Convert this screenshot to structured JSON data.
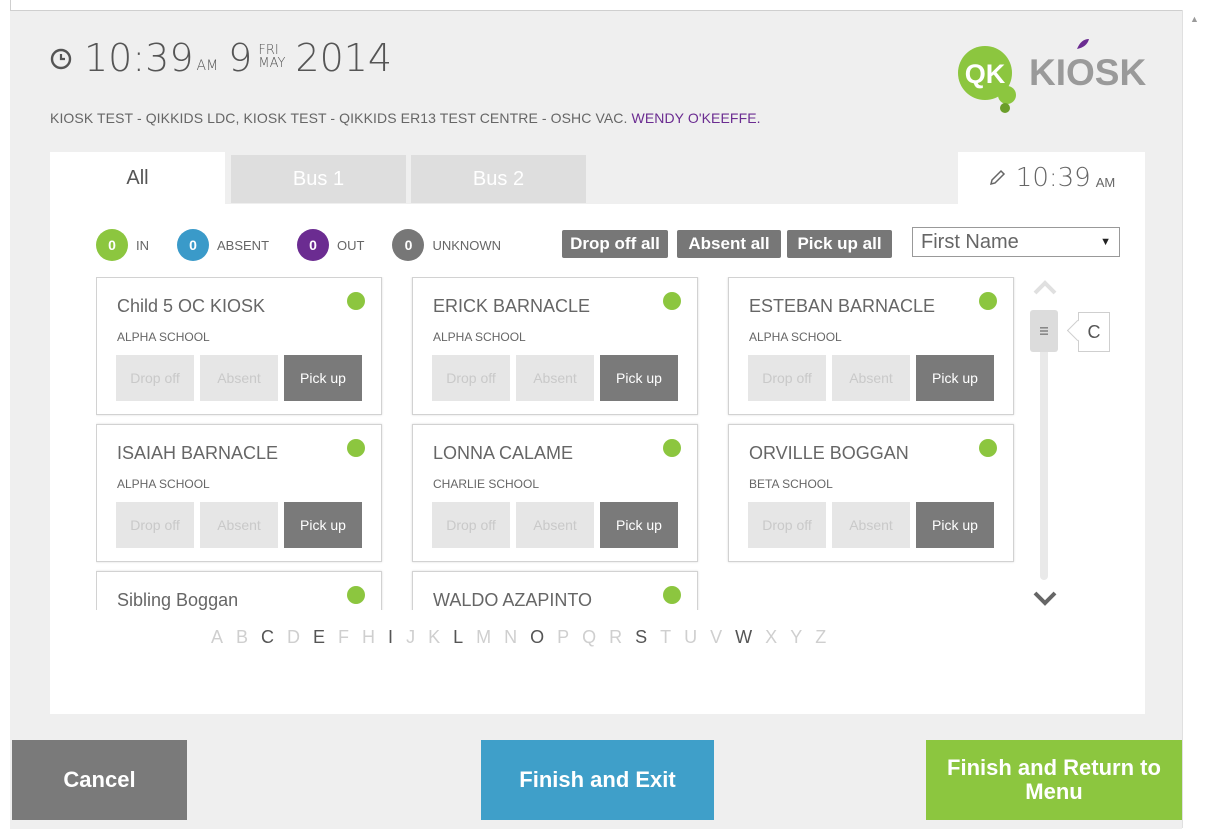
{
  "header": {
    "time": "10:39",
    "ampm": "AM",
    "day_num": "9",
    "day_name": "FRI",
    "month": "MAY",
    "year": "2014",
    "centres": "KIOSK TEST - QIKKIDS LDC, KIOSK TEST - QIKKIDS ER13 TEST CENTRE - OSHC VAC.",
    "user": "WENDY O'KEEFFE."
  },
  "logo": {
    "mark": "QK",
    "word": "KIOSK"
  },
  "tabs": [
    {
      "label": "All",
      "active": true
    },
    {
      "label": "Bus 1",
      "active": false
    },
    {
      "label": "Bus 2",
      "active": false
    }
  ],
  "tab_time": {
    "time": "10:39",
    "ampm": "AM"
  },
  "legend": [
    {
      "count": "0",
      "label": "IN",
      "color": "#8cc63f"
    },
    {
      "count": "0",
      "label": "ABSENT",
      "color": "#3a9ac9"
    },
    {
      "count": "0",
      "label": "OUT",
      "color": "#6b2c91"
    },
    {
      "count": "0",
      "label": "UNKNOWN",
      "color": "#777777"
    }
  ],
  "bulk_actions": [
    "Drop off all",
    "Absent all",
    "Pick up all"
  ],
  "sort": {
    "selected": "First Name"
  },
  "card_buttons": {
    "drop": "Drop off",
    "absent": "Absent",
    "pickup": "Pick up"
  },
  "children": [
    {
      "name": "Child 5 OC KIOSK",
      "school": "ALPHA SCHOOL"
    },
    {
      "name": "ERICK BARNACLE",
      "school": "ALPHA SCHOOL"
    },
    {
      "name": "ESTEBAN BARNACLE",
      "school": "ALPHA SCHOOL"
    },
    {
      "name": "ISAIAH BARNACLE",
      "school": "ALPHA SCHOOL"
    },
    {
      "name": "LONNA CALAME",
      "school": "CHARLIE SCHOOL"
    },
    {
      "name": "ORVILLE BOGGAN",
      "school": "BETA SCHOOL"
    },
    {
      "name": "Sibling Boggan",
      "school": ""
    },
    {
      "name": "WALDO AZAPINTO",
      "school": ""
    }
  ],
  "scroll_letter": "C",
  "alphabet": [
    {
      "l": "A",
      "on": false
    },
    {
      "l": "B",
      "on": false
    },
    {
      "l": "C",
      "on": true
    },
    {
      "l": "D",
      "on": false
    },
    {
      "l": "E",
      "on": true
    },
    {
      "l": "F",
      "on": false
    },
    {
      "l": "H",
      "on": false
    },
    {
      "l": "I",
      "on": true
    },
    {
      "l": "J",
      "on": false
    },
    {
      "l": "K",
      "on": false
    },
    {
      "l": "L",
      "on": true
    },
    {
      "l": "M",
      "on": false
    },
    {
      "l": "N",
      "on": false
    },
    {
      "l": "O",
      "on": true
    },
    {
      "l": "P",
      "on": false
    },
    {
      "l": "Q",
      "on": false
    },
    {
      "l": "R",
      "on": false
    },
    {
      "l": "S",
      "on": true
    },
    {
      "l": "T",
      "on": false
    },
    {
      "l": "U",
      "on": false
    },
    {
      "l": "V",
      "on": false
    },
    {
      "l": "W",
      "on": true
    },
    {
      "l": "X",
      "on": false
    },
    {
      "l": "Y",
      "on": false
    },
    {
      "l": "Z",
      "on": false
    }
  ],
  "footer": {
    "cancel": "Cancel",
    "finish": "Finish and Exit",
    "finish_menu": "Finish and Return to Menu"
  },
  "colors": {
    "green": "#8cc63f",
    "blue": "#3f9fc9",
    "purple": "#6b2c91",
    "gray": "#7a7a7a"
  }
}
